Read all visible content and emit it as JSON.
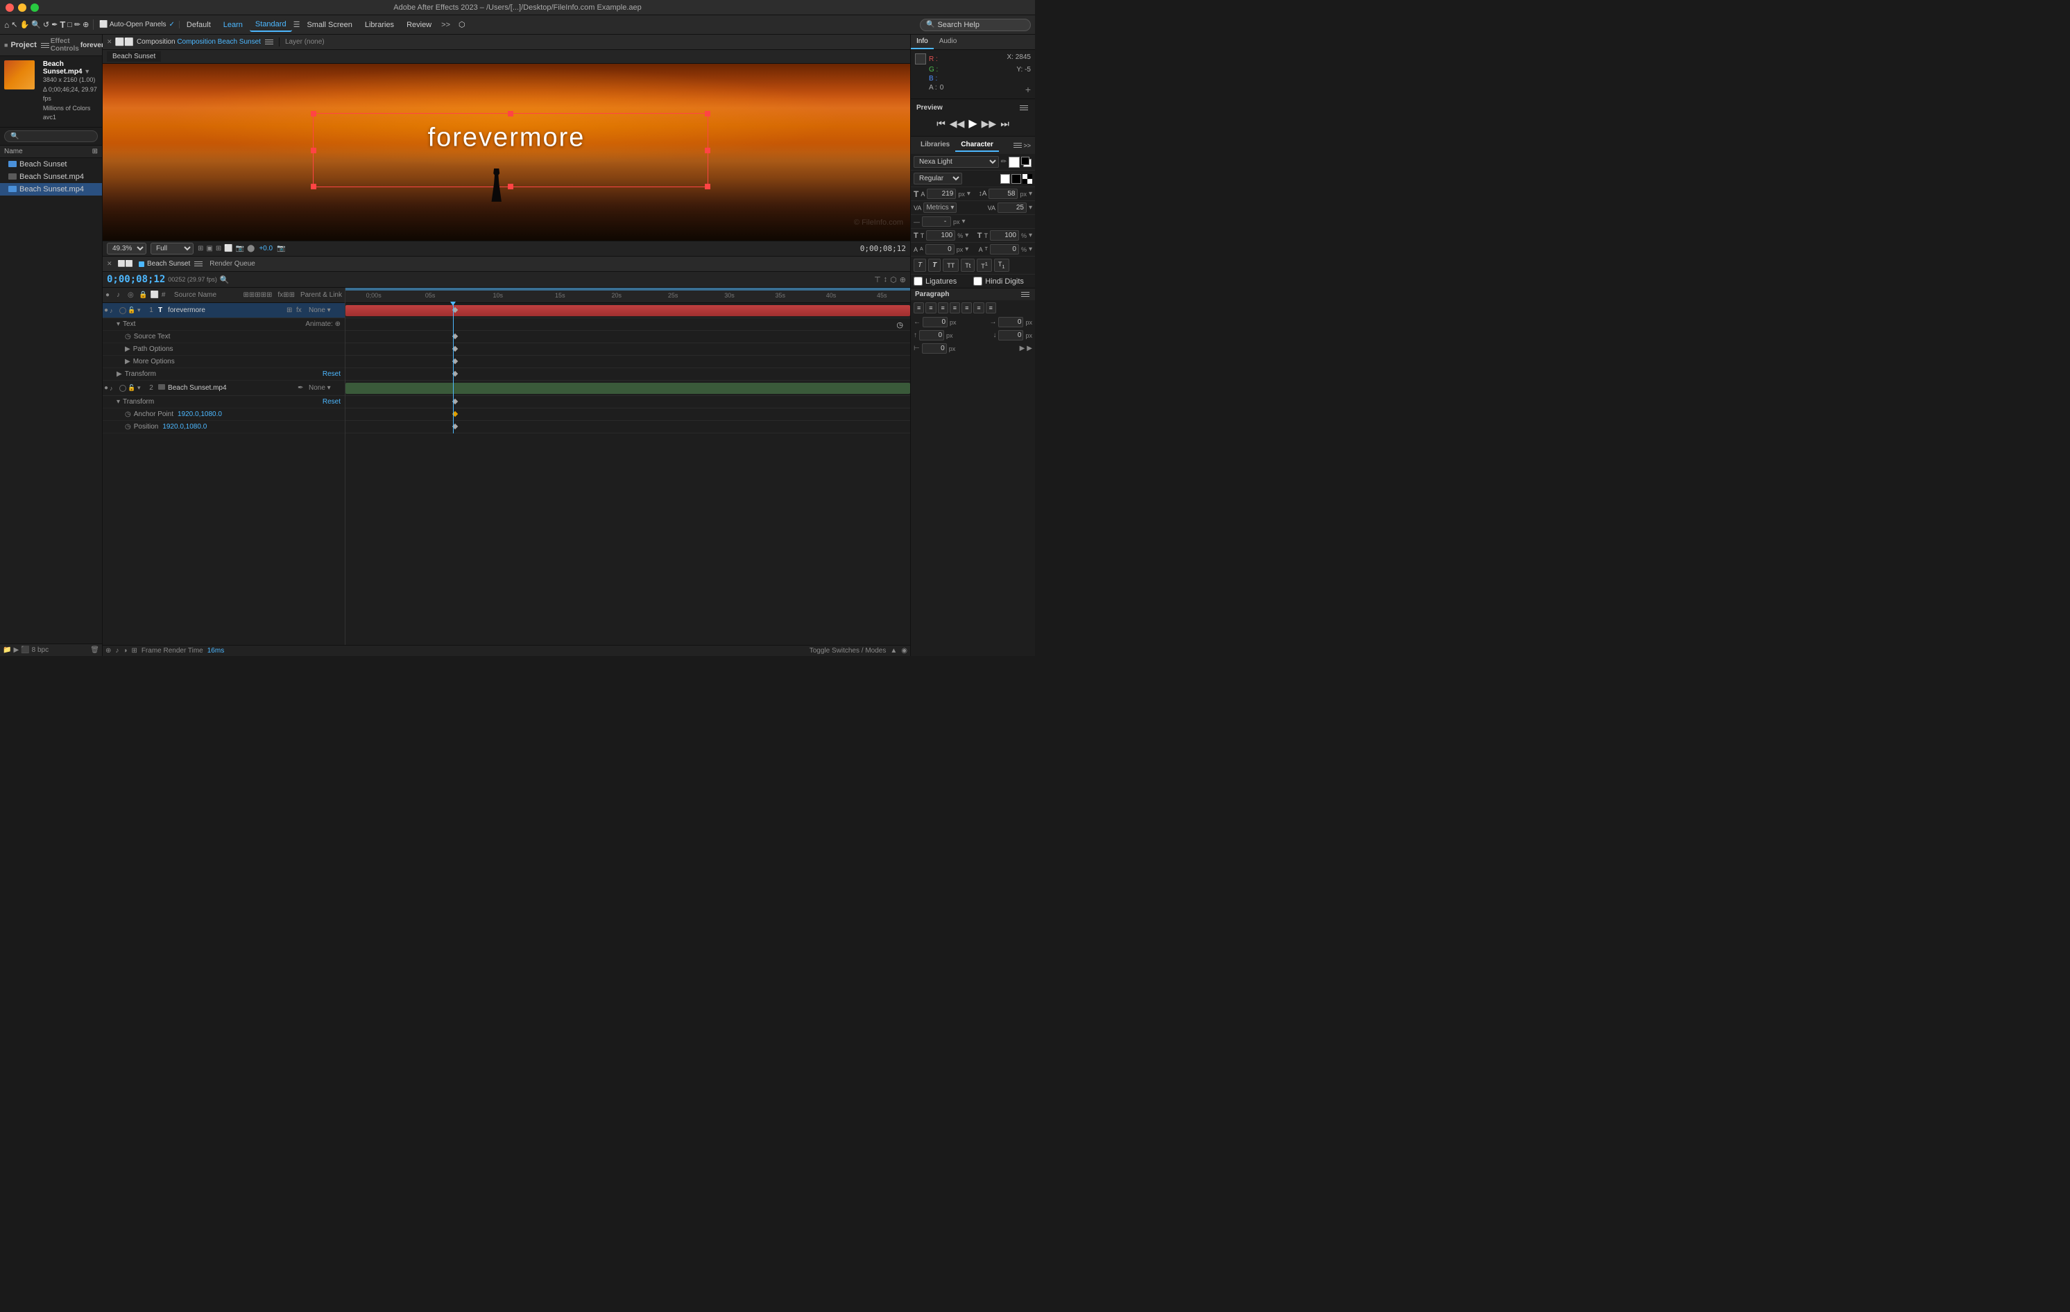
{
  "titleBar": {
    "title": "Adobe After Effects 2023 – /Users/[...]/Desktop/FileInfo.com Example.aep"
  },
  "menuBar": {
    "items": [
      "Home",
      "Arrow",
      "Hand",
      "Zoom",
      "Rotate",
      "Pen",
      "Text",
      "Shape",
      "Brush",
      "Puppet"
    ],
    "panels": [
      "Auto-Open Panels",
      "Default",
      "Learn",
      "Standard",
      "Small Screen",
      "Libraries",
      "Review"
    ],
    "searchPlaceholder": "Search Help"
  },
  "leftPanel": {
    "title": "Project",
    "effectControls": "Effect Controls",
    "footageName": "forevermore",
    "fileInfo": {
      "name": "Beach Sunset.mp4",
      "resolution": "3840 x 2160 (1.00)",
      "duration": "Δ 0;00;46;24, 29.97 fps",
      "colorMode": "Millions of Colors",
      "codec": "avc1"
    },
    "items": [
      {
        "type": "comp",
        "name": "Beach Sunset"
      },
      {
        "type": "video",
        "name": "Beach Sunset.mp4"
      },
      {
        "type": "video",
        "name": "Beach Sunset.mp4",
        "selected": true
      }
    ]
  },
  "compPanel": {
    "tabLabel": "Composition Beach Sunset",
    "layerLabel": "Layer (none)",
    "breadcrumb": "Beach Sunset",
    "zoomLevel": "(49.3%)",
    "quality": "Full",
    "gain": "+0.0",
    "timecode": "0;00;08;12",
    "textContent": "forevermore"
  },
  "rightPanel": {
    "infoTab": "Info",
    "audioTab": "Audio",
    "colorValues": {
      "R": "",
      "G": "",
      "B": "",
      "A": "0"
    },
    "coordinates": {
      "X": "X: 2845",
      "Y": "Y: -5"
    },
    "previewLabel": "Preview",
    "characterLabel": "Character",
    "librariesTab": "Libraries",
    "characterTab": "Character",
    "fontName": "Nexa Light",
    "fontStyle": "Regular",
    "fontSize": "219 px",
    "lineHeight": "58 px",
    "tracking": "Metrics",
    "tsukuriValue": "25",
    "vertScale": "100 %",
    "horizScale": "100 %",
    "baselineShift": "0 px",
    "tsume": "0 %",
    "strokeWidth": "- px",
    "formatButtons": [
      "T",
      "T",
      "TT",
      "Tt",
      "T̲",
      "T₁"
    ],
    "ligatures": "Ligatures",
    "hindiDigits": "Hindi Digits",
    "paragraphLabel": "Paragraph",
    "paragraphSpacing": {
      "left": "0 px",
      "right": "0 px",
      "spaceBefore": "0 px",
      "spaceAfter": "0 px"
    }
  },
  "timeline": {
    "tabLabel": "Beach Sunset",
    "renderQueue": "Render Queue",
    "currentTime": "0;00;08;12",
    "fps": "00252 (29.97 fps)",
    "layers": [
      {
        "num": "1",
        "type": "text",
        "name": "forevermore",
        "parent": "None",
        "selected": true,
        "subItems": [
          {
            "label": "Text",
            "hasAnimate": true
          },
          {
            "label": "Source Text",
            "indent": 2
          },
          {
            "label": "Path Options",
            "indent": 2
          },
          {
            "label": "More Options",
            "indent": 2
          },
          {
            "label": "Transform",
            "reset": "Reset"
          }
        ]
      },
      {
        "num": "2",
        "type": "video",
        "name": "Beach Sunset.mp4",
        "parent": "None",
        "subItems": [
          {
            "label": "Transform",
            "reset": "Reset"
          },
          {
            "label": "Anchor Point",
            "value": "1920.0,1080.0",
            "indent": 2
          },
          {
            "label": "Position",
            "value": "1920.0,1080.0",
            "indent": 2
          }
        ]
      }
    ],
    "frameRenderTime": "Frame Render Time",
    "renderTimeValue": "16ms",
    "toggleSwitches": "Toggle Switches / Modes"
  },
  "icons": {
    "eye": "●",
    "text": "T",
    "video": "▶",
    "search": "🔍",
    "play": "▶",
    "rewind": "◀◀",
    "stepBack": "◀",
    "stepForward": "▶",
    "fastForward": "▶▶",
    "firstFrame": "⏮",
    "lastFrame": "⏭"
  }
}
